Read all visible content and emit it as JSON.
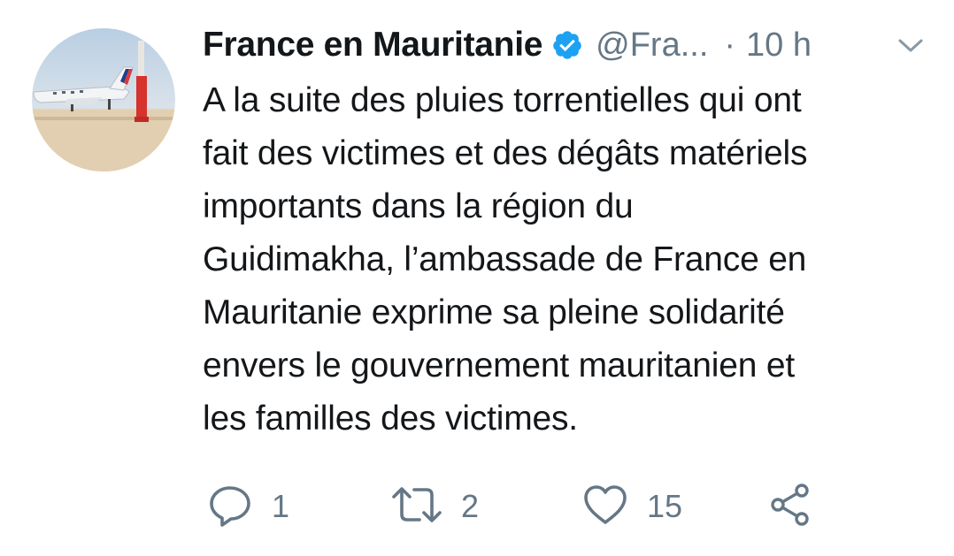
{
  "tweet": {
    "display_name": "France en Mauritanie",
    "handle": "@Fra...",
    "separator": "·",
    "time": "10 h",
    "text": "A la suite des pluies torrentielles qui ont\nfait des victimes et des dégâts matériels\nimportants dans la région du\nGuidimakha, l’ambassade de France en\nMauritanie exprime sa pleine solidarité\nenvers le gouvernement mauritanien et\nles familles des victimes.",
    "verified": true
  },
  "actions": {
    "reply_count": "1",
    "retweet_count": "2",
    "like_count": "15"
  },
  "icons": {
    "verified": "verified-badge-icon",
    "caret": "chevron-down-icon",
    "reply": "reply-icon",
    "retweet": "retweet-icon",
    "like": "heart-icon",
    "share": "share-icon"
  },
  "colors": {
    "text": "#14171a",
    "secondary": "#657786",
    "verified": "#1da1f2"
  }
}
